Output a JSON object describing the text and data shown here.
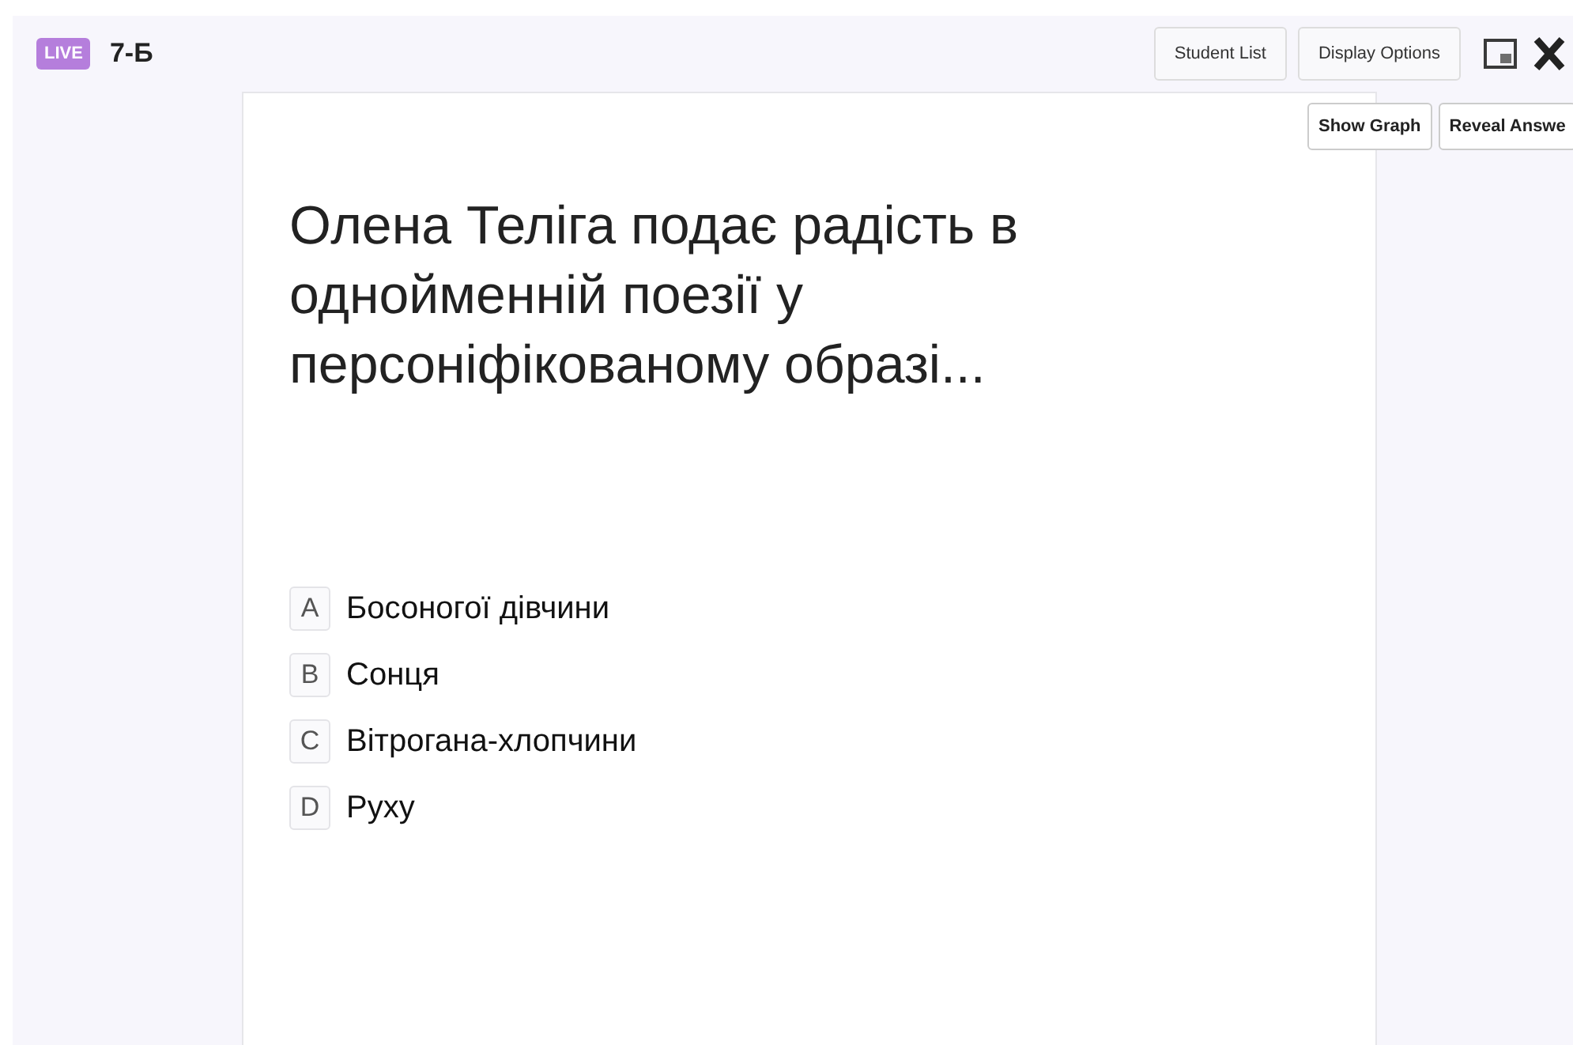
{
  "header": {
    "badge": "LIVE",
    "title": "7-Б",
    "buttons": [
      "Student List",
      "Display Options"
    ]
  },
  "question": {
    "text": "Олена Теліга подає радість в однойменній поезії у персоніфікованому образі...",
    "options": [
      {
        "letter": "A",
        "text": "Босоногої дівчини"
      },
      {
        "letter": "B",
        "text": "Сонця"
      },
      {
        "letter": "C",
        "text": "Вітрогана-хлопчини"
      },
      {
        "letter": "D",
        "text": "Руху"
      }
    ]
  },
  "card_actions": [
    "Show Graph",
    "Reveal Answe"
  ]
}
